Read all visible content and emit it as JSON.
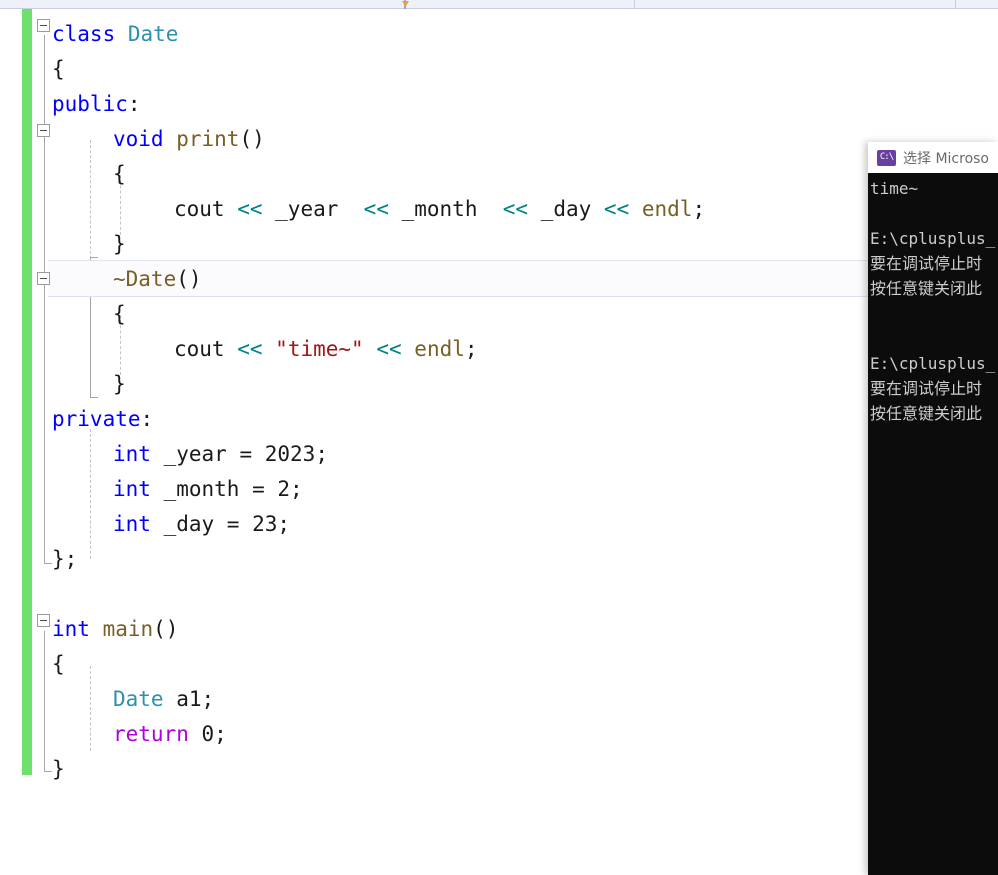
{
  "window": {
    "app": "visual-studio-code-editor"
  },
  "navbar": {
    "marker_icon": "dropdown-marker"
  },
  "editor": {
    "change_bar_color": "#6ee06e",
    "current_line": "~Date()",
    "lines": [
      {
        "n": 1,
        "indent": 0,
        "tokens": [
          {
            "t": "class ",
            "c": "kw"
          },
          {
            "t": "Date",
            "c": "type"
          }
        ]
      },
      {
        "n": 2,
        "indent": 0,
        "tokens": [
          {
            "t": "{",
            "c": "pl"
          }
        ]
      },
      {
        "n": 3,
        "indent": 0,
        "tokens": [
          {
            "t": "public",
            "c": "kw"
          },
          {
            "t": ":",
            "c": "pl"
          }
        ]
      },
      {
        "n": 4,
        "indent": 1,
        "tokens": [
          {
            "t": "void ",
            "c": "kw"
          },
          {
            "t": "print",
            "c": "fn"
          },
          {
            "t": "()",
            "c": "pl"
          }
        ]
      },
      {
        "n": 5,
        "indent": 1,
        "tokens": [
          {
            "t": "{",
            "c": "pl"
          }
        ]
      },
      {
        "n": 6,
        "indent": 2,
        "tokens": [
          {
            "t": "cout ",
            "c": "pl"
          },
          {
            "t": "<<",
            "c": "op"
          },
          {
            "t": " _year  ",
            "c": "pl"
          },
          {
            "t": "<<",
            "c": "op"
          },
          {
            "t": " _month  ",
            "c": "pl"
          },
          {
            "t": "<<",
            "c": "op"
          },
          {
            "t": " _day ",
            "c": "pl"
          },
          {
            "t": "<<",
            "c": "op"
          },
          {
            "t": " ",
            "c": "pl"
          },
          {
            "t": "endl",
            "c": "fn"
          },
          {
            "t": ";",
            "c": "pl"
          }
        ]
      },
      {
        "n": 7,
        "indent": 1,
        "tokens": [
          {
            "t": "}",
            "c": "pl"
          }
        ]
      },
      {
        "n": 8,
        "indent": 1,
        "tokens": [
          {
            "t": "~Date",
            "c": "fn"
          },
          {
            "t": "()",
            "c": "pl"
          }
        ]
      },
      {
        "n": 9,
        "indent": 1,
        "tokens": [
          {
            "t": "{",
            "c": "pl"
          }
        ]
      },
      {
        "n": 10,
        "indent": 2,
        "tokens": [
          {
            "t": "cout ",
            "c": "pl"
          },
          {
            "t": "<<",
            "c": "op"
          },
          {
            "t": " ",
            "c": "pl"
          },
          {
            "t": "\"time~\"",
            "c": "str"
          },
          {
            "t": " ",
            "c": "pl"
          },
          {
            "t": "<<",
            "c": "op"
          },
          {
            "t": " ",
            "c": "pl"
          },
          {
            "t": "endl",
            "c": "fn"
          },
          {
            "t": ";",
            "c": "pl"
          }
        ]
      },
      {
        "n": 11,
        "indent": 1,
        "tokens": [
          {
            "t": "}",
            "c": "pl"
          }
        ]
      },
      {
        "n": 12,
        "indent": 0,
        "tokens": [
          {
            "t": "private",
            "c": "kw"
          },
          {
            "t": ":",
            "c": "pl"
          }
        ]
      },
      {
        "n": 13,
        "indent": 1,
        "tokens": [
          {
            "t": "int",
            "c": "kw"
          },
          {
            "t": " _year = ",
            "c": "pl"
          },
          {
            "t": "2023",
            "c": "num"
          },
          {
            "t": ";",
            "c": "pl"
          }
        ]
      },
      {
        "n": 14,
        "indent": 1,
        "tokens": [
          {
            "t": "int",
            "c": "kw"
          },
          {
            "t": " _month = ",
            "c": "pl"
          },
          {
            "t": "2",
            "c": "num"
          },
          {
            "t": ";",
            "c": "pl"
          }
        ]
      },
      {
        "n": 15,
        "indent": 1,
        "tokens": [
          {
            "t": "int",
            "c": "kw"
          },
          {
            "t": " _day = ",
            "c": "pl"
          },
          {
            "t": "23",
            "c": "num"
          },
          {
            "t": ";",
            "c": "pl"
          }
        ]
      },
      {
        "n": 16,
        "indent": 0,
        "tokens": [
          {
            "t": "};",
            "c": "pl"
          }
        ]
      },
      {
        "n": 17,
        "indent": 0,
        "tokens": []
      },
      {
        "n": 18,
        "indent": 0,
        "tokens": [
          {
            "t": "int ",
            "c": "kw"
          },
          {
            "t": "main",
            "c": "fn"
          },
          {
            "t": "()",
            "c": "pl"
          }
        ]
      },
      {
        "n": 19,
        "indent": 0,
        "tokens": [
          {
            "t": "{",
            "c": "pl"
          }
        ]
      },
      {
        "n": 20,
        "indent": 1,
        "tokens": [
          {
            "t": "Date",
            "c": "type"
          },
          {
            "t": " a1;",
            "c": "pl"
          }
        ]
      },
      {
        "n": 21,
        "indent": 1,
        "tokens": [
          {
            "t": "return",
            "c": "ctl"
          },
          {
            "t": " ",
            "c": "pl"
          },
          {
            "t": "0",
            "c": "num"
          },
          {
            "t": ";",
            "c": "pl"
          }
        ]
      },
      {
        "n": 22,
        "indent": 0,
        "tokens": [
          {
            "t": "}",
            "c": "pl"
          }
        ]
      }
    ],
    "outlining": [
      {
        "name": "collapse-class-date",
        "line": 1
      },
      {
        "name": "collapse-print-method",
        "line": 4
      },
      {
        "name": "collapse-destructor",
        "line": 8
      },
      {
        "name": "collapse-main-function",
        "line": 18
      }
    ]
  },
  "console": {
    "icon": "console-app-icon",
    "title": "选择 Microso",
    "lines": [
      {
        "text": "time~",
        "cjk": false
      },
      {
        "text": "",
        "cjk": false
      },
      {
        "text": "E:\\cplusplus_",
        "cjk": false
      },
      {
        "text": "要在调试停止时",
        "cjk": true
      },
      {
        "text": "按任意键关闭此",
        "cjk": true
      },
      {
        "text": "",
        "cjk": false
      },
      {
        "text": "",
        "cjk": false
      },
      {
        "text": "E:\\cplusplus_",
        "cjk": false
      },
      {
        "text": "要在调试停止时",
        "cjk": true
      },
      {
        "text": "按任意键关闭此",
        "cjk": true
      }
    ]
  }
}
